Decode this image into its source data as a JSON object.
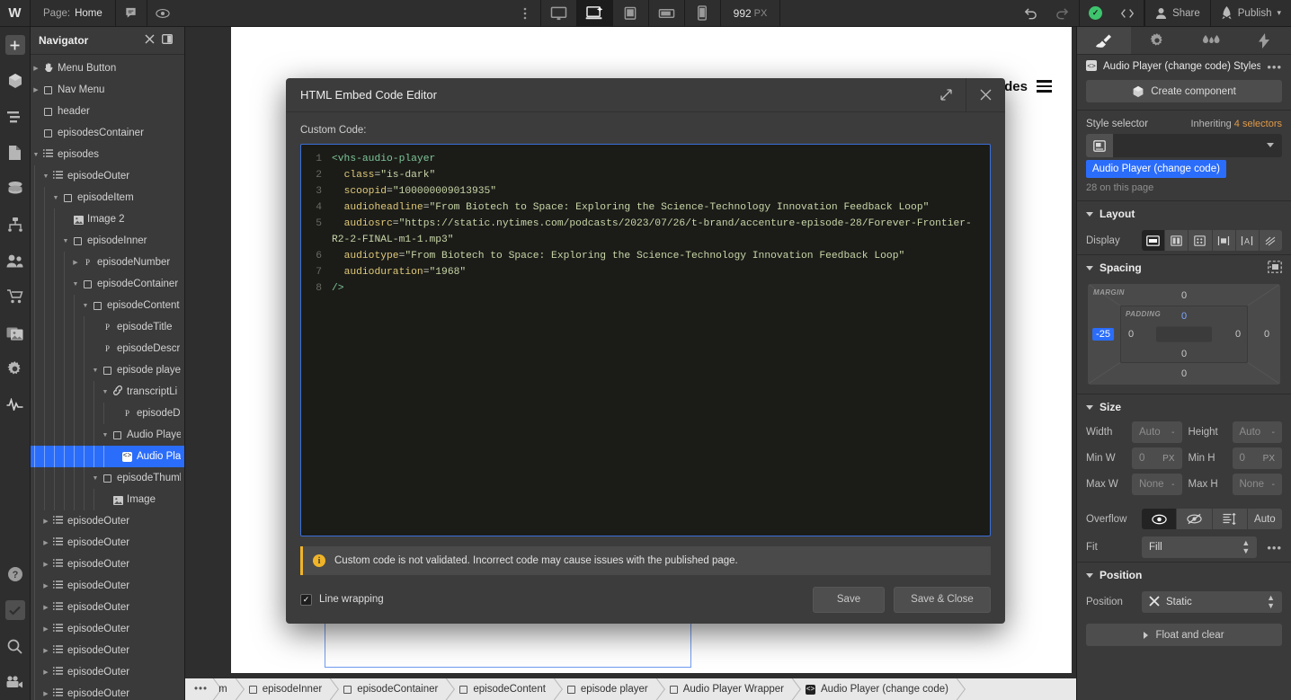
{
  "topbar": {
    "logo": "W",
    "page_prefix": "Page:",
    "page_name": "Home",
    "comment_icon": "comment-icon",
    "preview_icon": "eye-icon",
    "dots_icon": "more-vertical-icon",
    "devices": [
      {
        "name": "desktop-large",
        "icon": "monitor-icon",
        "active": false
      },
      {
        "name": "desktop-base",
        "icon": "laptop-star-icon",
        "active": true
      },
      {
        "name": "tablet",
        "icon": "tablet-icon",
        "active": false
      },
      {
        "name": "mobile-landscape",
        "icon": "mobile-landscape-icon",
        "active": false
      },
      {
        "name": "mobile-portrait",
        "icon": "mobile-icon",
        "active": false
      }
    ],
    "viewport_value": "992",
    "viewport_unit": "PX",
    "undo_icon": "undo-icon",
    "redo_icon": "redo-icon",
    "status_icon": "check-circle-icon",
    "code_icon": "code-brackets-icon",
    "share_label": "Share",
    "publish_label": "Publish"
  },
  "rail": {
    "items": [
      {
        "name": "add-elements",
        "icon": "plus-square-icon"
      },
      {
        "name": "components",
        "icon": "cube-icon"
      },
      {
        "name": "navigator",
        "icon": "layers-list-icon"
      },
      {
        "name": "pages",
        "icon": "page-icon"
      },
      {
        "name": "cms",
        "icon": "database-icon"
      },
      {
        "name": "logic",
        "icon": "sitemap-icon"
      },
      {
        "name": "users",
        "icon": "users-icon"
      },
      {
        "name": "ecommerce",
        "icon": "cart-icon"
      },
      {
        "name": "assets",
        "icon": "images-icon"
      },
      {
        "name": "settings",
        "icon": "gear-icon"
      },
      {
        "name": "interactions",
        "icon": "pulse-icon"
      }
    ],
    "bottom_items": [
      {
        "name": "help",
        "icon": "question-circle-icon"
      },
      {
        "name": "audit",
        "icon": "checkbox-icon"
      },
      {
        "name": "search",
        "icon": "magnifier-icon"
      },
      {
        "name": "video",
        "icon": "video-camera-icon"
      }
    ]
  },
  "navigator": {
    "title": "Navigator",
    "close_icon": "close-icon",
    "panel_icon": "panel-toggle-icon",
    "items": [
      {
        "label": "Menu Button",
        "depth": 0,
        "glyph": "hand",
        "twisty": "right"
      },
      {
        "label": "Nav Menu",
        "depth": 0,
        "glyph": "box",
        "twisty": "right"
      },
      {
        "label": "header",
        "depth": 0,
        "glyph": "box",
        "twisty": "none"
      },
      {
        "label": "episodesContainer",
        "depth": 0,
        "glyph": "box",
        "twisty": "none"
      },
      {
        "label": "episodes",
        "depth": 0,
        "glyph": "list",
        "twisty": "down"
      },
      {
        "label": "episodeOuter",
        "depth": 1,
        "glyph": "list",
        "twisty": "down"
      },
      {
        "label": "episodeItem",
        "depth": 2,
        "glyph": "box",
        "twisty": "down"
      },
      {
        "label": "Image 2",
        "depth": 3,
        "glyph": "image",
        "twisty": "none"
      },
      {
        "label": "episodeInner",
        "depth": 3,
        "glyph": "box",
        "twisty": "down"
      },
      {
        "label": "episodeNumber",
        "depth": 4,
        "glyph": "p",
        "twisty": "right"
      },
      {
        "label": "episodeContainer",
        "depth": 4,
        "glyph": "box",
        "twisty": "down"
      },
      {
        "label": "episodeContent",
        "depth": 5,
        "glyph": "box",
        "twisty": "down"
      },
      {
        "label": "episodeTitle",
        "depth": 6,
        "glyph": "p",
        "twisty": "none"
      },
      {
        "label": "episodeDescr",
        "depth": 6,
        "glyph": "p",
        "twisty": "none"
      },
      {
        "label": "episode playe",
        "depth": 6,
        "glyph": "box",
        "twisty": "down"
      },
      {
        "label": "transcriptLi",
        "depth": 7,
        "glyph": "link",
        "twisty": "down"
      },
      {
        "label": "episodeD",
        "depth": 8,
        "glyph": "p",
        "twisty": "none"
      },
      {
        "label": "Audio Playe",
        "depth": 7,
        "glyph": "box",
        "twisty": "down"
      },
      {
        "label": "Audio Pla",
        "depth": 8,
        "glyph": "code",
        "twisty": "none",
        "selected": true
      },
      {
        "label": "episodeThumbn",
        "depth": 6,
        "glyph": "box",
        "twisty": "down"
      },
      {
        "label": "Image",
        "depth": 7,
        "glyph": "image",
        "twisty": "none"
      },
      {
        "label": "episodeOuter",
        "depth": 1,
        "glyph": "list",
        "twisty": "right"
      },
      {
        "label": "episodeOuter",
        "depth": 1,
        "glyph": "list",
        "twisty": "right"
      },
      {
        "label": "episodeOuter",
        "depth": 1,
        "glyph": "list",
        "twisty": "right"
      },
      {
        "label": "episodeOuter",
        "depth": 1,
        "glyph": "list",
        "twisty": "right"
      },
      {
        "label": "episodeOuter",
        "depth": 1,
        "glyph": "list",
        "twisty": "right"
      },
      {
        "label": "episodeOuter",
        "depth": 1,
        "glyph": "list",
        "twisty": "right"
      },
      {
        "label": "episodeOuter",
        "depth": 1,
        "glyph": "list",
        "twisty": "right"
      },
      {
        "label": "episodeOuter",
        "depth": 1,
        "glyph": "list",
        "twisty": "right"
      },
      {
        "label": "episodeOuter",
        "depth": 1,
        "glyph": "list",
        "twisty": "right"
      }
    ]
  },
  "canvas": {
    "nav_text": "odes",
    "menu_icon": "hamburger-icon",
    "selected_badge": "code-badge"
  },
  "modal": {
    "title": "HTML Embed Code Editor",
    "expand_icon": "expand-diagonal-icon",
    "close_icon": "close-icon",
    "custom_code_label": "Custom Code:",
    "code_lines": [
      {
        "n": "1",
        "tokens": [
          {
            "t": "tag",
            "v": "<vhs-audio-player"
          }
        ]
      },
      {
        "n": "2",
        "tokens": [
          {
            "t": "plain",
            "v": "  "
          },
          {
            "t": "attr",
            "v": "class"
          },
          {
            "t": "eq",
            "v": "="
          },
          {
            "t": "str",
            "v": "\"is-dark\""
          }
        ]
      },
      {
        "n": "3",
        "tokens": [
          {
            "t": "plain",
            "v": "  "
          },
          {
            "t": "attr",
            "v": "scoopid"
          },
          {
            "t": "eq",
            "v": "="
          },
          {
            "t": "str",
            "v": "\"100000009013935\""
          }
        ]
      },
      {
        "n": "4",
        "tokens": [
          {
            "t": "plain",
            "v": "  "
          },
          {
            "t": "attr",
            "v": "audioheadline"
          },
          {
            "t": "eq",
            "v": "="
          },
          {
            "t": "str",
            "v": "\"From Biotech to Space: Exploring the Science-Technology Innovation Feedback Loop\""
          }
        ]
      },
      {
        "n": "5",
        "tokens": [
          {
            "t": "plain",
            "v": "  "
          },
          {
            "t": "attr",
            "v": "audiosrc"
          },
          {
            "t": "eq",
            "v": "="
          },
          {
            "t": "str",
            "v": "\"https://static.nytimes.com/podcasts/2023/07/26/t-brand/accenture-episode-28/Forever-Frontier-R2-2-FINAL-m1-1.mp3\""
          }
        ]
      },
      {
        "n": "6",
        "tokens": [
          {
            "t": "plain",
            "v": "  "
          },
          {
            "t": "attr",
            "v": "audiotype"
          },
          {
            "t": "eq",
            "v": "="
          },
          {
            "t": "str",
            "v": "\"From Biotech to Space: Exploring the Science-Technology Innovation Feedback Loop\""
          }
        ]
      },
      {
        "n": "7",
        "tokens": [
          {
            "t": "plain",
            "v": "  "
          },
          {
            "t": "attr",
            "v": "audioduration"
          },
          {
            "t": "eq",
            "v": "="
          },
          {
            "t": "str",
            "v": "\"1968\""
          }
        ]
      },
      {
        "n": "8",
        "tokens": [
          {
            "t": "tag",
            "v": "/>"
          }
        ]
      }
    ],
    "warning_icon": "info-circle-icon",
    "warning_text": "Custom code is not validated. Incorrect code may cause issues with the published page.",
    "line_wrapping_label": "Line wrapping",
    "line_wrapping_checked": true,
    "checkmark": "✓",
    "save_label": "Save",
    "save_close_label": "Save & Close"
  },
  "right_panel": {
    "tabs": [
      {
        "name": "style",
        "icon": "paintbrush-icon",
        "active": true
      },
      {
        "name": "settings",
        "icon": "gear-icon",
        "active": false
      },
      {
        "name": "style-manager",
        "icon": "drops-icon",
        "active": false
      },
      {
        "name": "interactions",
        "icon": "bolt-icon",
        "active": false
      }
    ],
    "selection_icon": "code-badge-icon",
    "selection_name": "Audio Player (change code) Styles",
    "overflow_icon": "more-horizontal-icon",
    "create_component_label": "Create component",
    "create_component_icon": "cube-icon",
    "style_selector_label": "Style selector",
    "inheriting_prefix": "Inheriting",
    "inheriting_count": "4 selectors",
    "selector_field_icon": "embed-icon",
    "selector_chip": "Audio Player (change code)",
    "usage_note": "28 on this page",
    "layout": {
      "title": "Layout",
      "display_label": "Display",
      "options": [
        {
          "name": "display-block",
          "icon": "block-icon",
          "active": true
        },
        {
          "name": "display-flex",
          "icon": "flex-icon",
          "active": false
        },
        {
          "name": "display-grid",
          "icon": "grid-icon",
          "active": false
        },
        {
          "name": "display-inline-block",
          "icon": "inline-block-icon",
          "active": false
        },
        {
          "name": "display-inline",
          "icon": "inline-icon",
          "active": false
        },
        {
          "name": "display-none",
          "icon": "none-icon",
          "active": false
        }
      ]
    },
    "spacing": {
      "title": "Spacing",
      "mode_icon": "spacing-mode-icon",
      "margin_label": "MARGIN",
      "padding_label": "PADDING",
      "margin_top": "0",
      "margin_right": "0",
      "margin_bottom": "0",
      "margin_left": "-25",
      "padding_top": "0",
      "padding_right": "0",
      "padding_bottom": "0",
      "padding_left": "0"
    },
    "size": {
      "title": "Size",
      "width_label": "Width",
      "width_value": "Auto",
      "height_label": "Height",
      "height_value": "Auto",
      "minw_label": "Min W",
      "minw_value": "0",
      "minh_label": "Min H",
      "minh_value": "0",
      "maxw_label": "Max W",
      "maxw_value": "None",
      "maxh_label": "Max H",
      "maxh_value": "None",
      "unit": "PX",
      "overflow_label": "Overflow",
      "overflow_options": [
        {
          "name": "overflow-visible",
          "icon": "eye-icon",
          "active": true
        },
        {
          "name": "overflow-hidden",
          "icon": "eye-off-icon",
          "active": false
        },
        {
          "name": "overflow-scroll",
          "icon": "scroll-icon",
          "active": false
        },
        {
          "name": "overflow-auto",
          "label": "Auto",
          "active": false
        }
      ],
      "fit_label": "Fit",
      "fit_value": "Fill",
      "fit_more_icon": "more-horizontal-icon"
    },
    "position": {
      "title": "Position",
      "position_label": "Position",
      "position_value": "Static",
      "position_icon": "close-x-icon",
      "float_clear_label": "Float and clear"
    }
  },
  "breadcrumbs": {
    "more_icon": "ellipsis-icon",
    "items": [
      {
        "label": "m",
        "glyph": "none",
        "clipped": true
      },
      {
        "label": "episodeInner",
        "glyph": "box"
      },
      {
        "label": "episodeContainer",
        "glyph": "box"
      },
      {
        "label": "episodeContent",
        "glyph": "box"
      },
      {
        "label": "episode player",
        "glyph": "box"
      },
      {
        "label": "Audio Player Wrapper",
        "glyph": "box"
      },
      {
        "label": "Audio Player (change code)",
        "glyph": "code"
      }
    ]
  }
}
